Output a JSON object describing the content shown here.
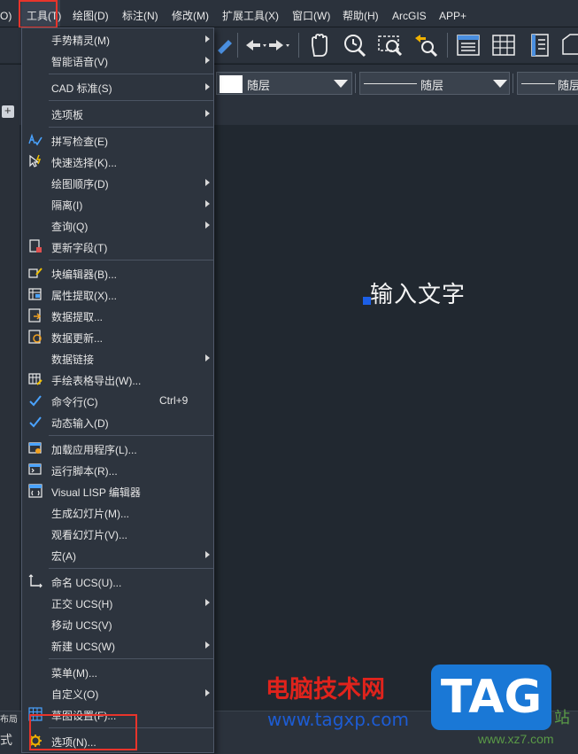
{
  "menubar": {
    "items": [
      {
        "label": "O)"
      },
      {
        "label": "工具(T)"
      },
      {
        "label": "绘图(D)"
      },
      {
        "label": "标注(N)"
      },
      {
        "label": "修改(M)"
      },
      {
        "label": "扩展工具(X)"
      },
      {
        "label": "窗口(W)"
      },
      {
        "label": "帮助(H)"
      },
      {
        "label": "ArcGIS"
      },
      {
        "label": "APP+"
      }
    ]
  },
  "properties_bar": {
    "color_value": "随层",
    "linetype_value": "随层",
    "lineweight_value": "随层"
  },
  "canvas": {
    "text": "输入文字"
  },
  "statusbar": {
    "left_text_1": "布局",
    "left_text_2": "式"
  },
  "tools_menu": {
    "items": [
      {
        "label": "手势精灵(M)",
        "submenu": true
      },
      {
        "label": "智能语音(V)",
        "submenu": true
      },
      {
        "label": "CAD 标准(S)",
        "submenu": true
      },
      {
        "label": "选项板",
        "submenu": true
      },
      {
        "label": "拼写检查(E)",
        "icon": "spell-check-icon"
      },
      {
        "label": "快速选择(K)...",
        "icon": "quick-select-icon"
      },
      {
        "label": "绘图顺序(D)",
        "submenu": true
      },
      {
        "label": "隔离(I)",
        "submenu": true
      },
      {
        "label": "查询(Q)",
        "submenu": true
      },
      {
        "label": "更新字段(T)",
        "icon": "update-field-icon"
      },
      {
        "label": "块编辑器(B)...",
        "icon": "block-editor-icon"
      },
      {
        "label": "属性提取(X)...",
        "icon": "attribute-extract-icon"
      },
      {
        "label": "数据提取...",
        "icon": "data-extract-icon"
      },
      {
        "label": "数据更新...",
        "icon": "data-update-icon"
      },
      {
        "label": "数据链接",
        "submenu": true
      },
      {
        "label": "手绘表格导出(W)...",
        "icon": "table-export-icon"
      },
      {
        "label": "命令行(C)",
        "icon": "check-icon",
        "shortcut": "Ctrl+9"
      },
      {
        "label": "动态输入(D)",
        "icon": "check-icon"
      },
      {
        "label": "加载应用程序(L)...",
        "icon": "load-app-icon"
      },
      {
        "label": "运行脚本(R)...",
        "icon": "run-script-icon"
      },
      {
        "label": "Visual LISP 编辑器",
        "icon": "lisp-editor-icon"
      },
      {
        "label": "生成幻灯片(M)..."
      },
      {
        "label": "观看幻灯片(V)..."
      },
      {
        "label": "宏(A)",
        "submenu": true
      },
      {
        "label": "命名 UCS(U)...",
        "icon": "named-ucs-icon"
      },
      {
        "label": "正交 UCS(H)",
        "submenu": true
      },
      {
        "label": "移动 UCS(V)"
      },
      {
        "label": "新建 UCS(W)",
        "submenu": true
      },
      {
        "label": "菜单(M)..."
      },
      {
        "label": "自定义(O)",
        "submenu": true
      },
      {
        "label": "草图设置(F)...",
        "icon": "drafting-settings-icon"
      },
      {
        "label": "选项(N)...",
        "icon": "options-gear-icon"
      }
    ]
  },
  "watermark": {
    "site_name": "电脑技术网",
    "url": "www.tagxp.com",
    "badge": "TAG",
    "site2": "www.xz7.com",
    "site2_label": "站"
  },
  "colors": {
    "menubar_bg": "#2b323c",
    "canvas_bg": "#212830",
    "menu_bg": "#2d343e",
    "highlight_red": "#e8342b",
    "check_blue": "#4aa3ff"
  }
}
